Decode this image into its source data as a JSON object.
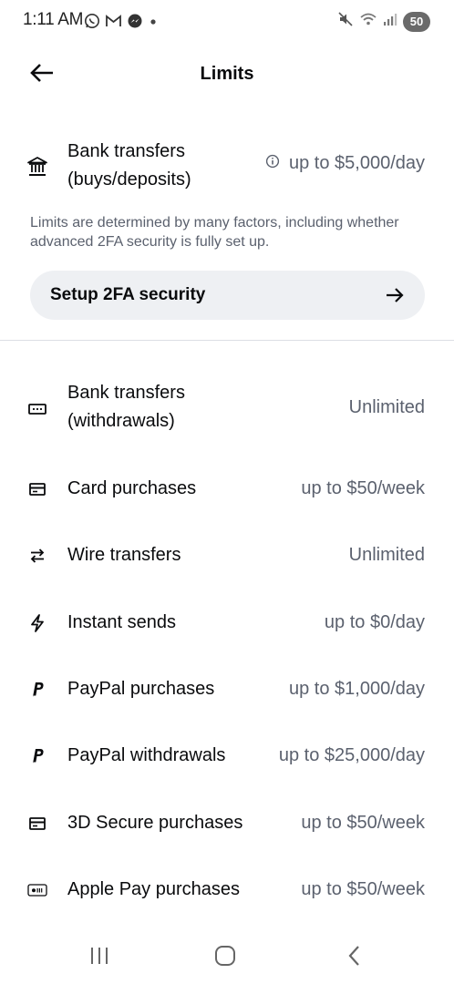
{
  "status_bar": {
    "time": "1:11 AM",
    "battery": "50",
    "left_icons": [
      "whatsapp-icon",
      "gmail-icon",
      "messenger-icon",
      "dot-icon"
    ],
    "right_icons": [
      "mute-icon",
      "wifi-icon",
      "signal-icon",
      "battery-icon"
    ]
  },
  "header": {
    "title": "Limits",
    "back_icon": "arrow-left-icon"
  },
  "bank_deposit": {
    "icon": "bank-icon",
    "label": "Bank transfers (buys/deposits)",
    "info_icon": "info-icon",
    "value": "up to $5,000/day"
  },
  "info_text": "Limits are determined by many factors, including whether advanced 2FA security is fully set up.",
  "setup_button": {
    "label": "Setup 2FA security",
    "icon": "arrow-right-icon"
  },
  "limits": [
    {
      "icon": "bank-withdrawal-icon",
      "label": "Bank transfers (withdrawals)",
      "value": "Unlimited"
    },
    {
      "icon": "card-icon",
      "label": "Card purchases",
      "value": "up to $50/week"
    },
    {
      "icon": "transfer-arrows-icon",
      "label": "Wire transfers",
      "value": "Unlimited"
    },
    {
      "icon": "lightning-icon",
      "label": "Instant sends",
      "value": "up to $0/day"
    },
    {
      "icon": "paypal-icon",
      "label": "PayPal purchases",
      "value": "up to $1,000/day"
    },
    {
      "icon": "paypal-icon",
      "label": "PayPal withdrawals",
      "value": "up to $25,000/day"
    },
    {
      "icon": "card-icon",
      "label": "3D Secure purchases",
      "value": "up to $50/week"
    },
    {
      "icon": "apple-pay-icon",
      "label": "Apple Pay purchases",
      "value": "up to $50/week"
    }
  ],
  "nav_bar": {
    "recents_icon": "recents-icon",
    "home_icon": "home-icon",
    "back_icon": "back-chevron-icon"
  }
}
